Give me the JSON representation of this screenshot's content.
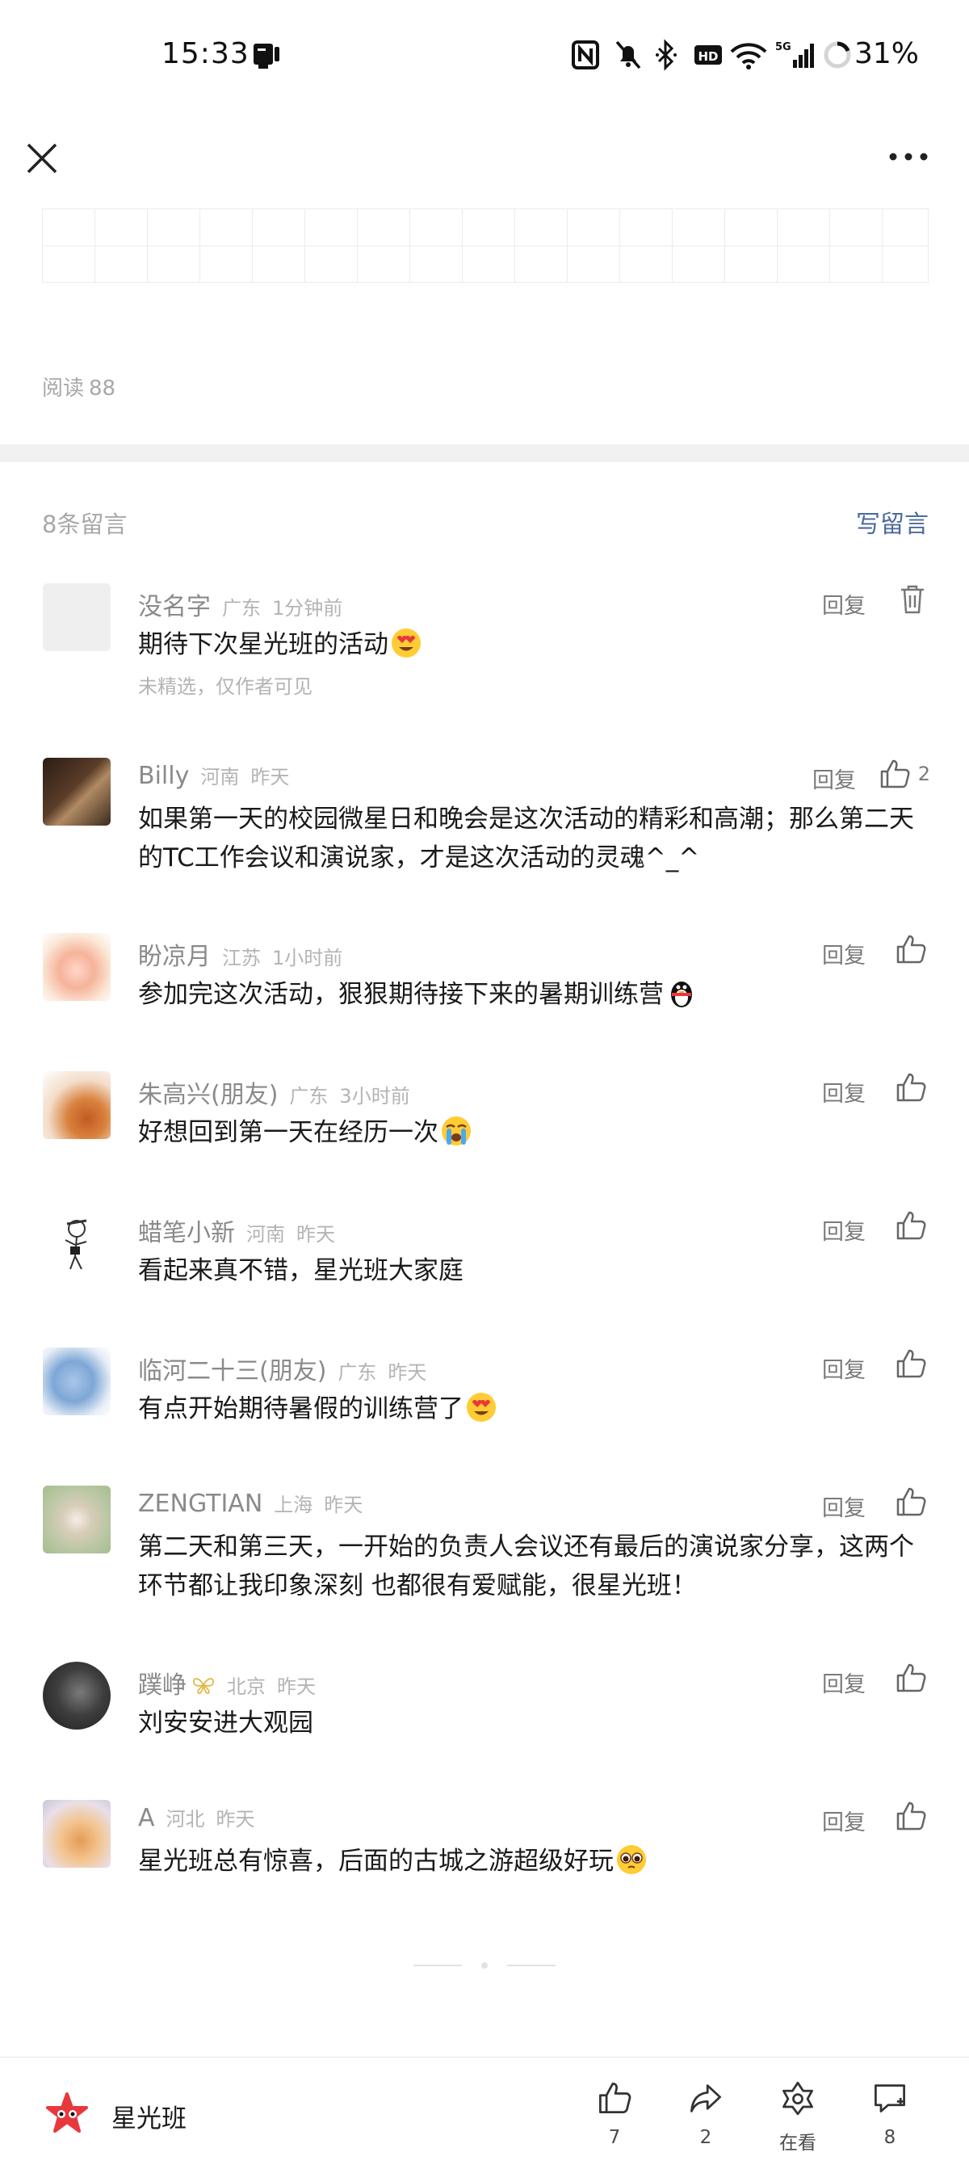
{
  "status_bar": {
    "time": "15:33",
    "battery": "31%",
    "icons": [
      "screen-record-icon",
      "nfc-icon",
      "mute-bell-icon",
      "bluetooth-icon",
      "hd-icon",
      "wifi-icon",
      "5g-signal-icon",
      "battery-ring-icon"
    ]
  },
  "nav": {
    "close_icon": "close-icon",
    "more_icon": "more-icon"
  },
  "article": {
    "read_label": "阅读",
    "read_count": "88"
  },
  "comments_section": {
    "count_label": "8条留言",
    "write_label": "写留言"
  },
  "comments": [
    {
      "name": "没名字",
      "location": "广东",
      "time": "1分钟前",
      "text": "期待下次星光班的活动",
      "emoji": "heart-eyes",
      "note": "未精选，仅作者可见",
      "reply": "回复",
      "action": "delete"
    },
    {
      "name": "Billy",
      "location": "河南",
      "time": "昨天",
      "text": "如果第一天的校园微星日和晚会是这次活动的精彩和高潮；那么第二天的TC工作会议和演说家，才是这次活动的灵魂^_^",
      "reply": "回复",
      "likes": "2"
    },
    {
      "name": "盼凉月",
      "location": "江苏",
      "time": "1小时前",
      "text": "参加完这次活动，狠狠期待接下来的暑期训练营",
      "emoji": "penguin",
      "reply": "回复"
    },
    {
      "name": "朱高兴(朋友)",
      "location": "广东",
      "time": "3小时前",
      "text": "好想回到第一天在经历一次",
      "emoji": "crying",
      "reply": "回复"
    },
    {
      "name": "蜡笔小新",
      "location": "河南",
      "time": "昨天",
      "text": "看起来真不错，星光班大家庭",
      "reply": "回复"
    },
    {
      "name": "临河二十三(朋友)",
      "location": "广东",
      "time": "昨天",
      "text": "有点开始期待暑假的训练营了",
      "emoji": "heart-eyes",
      "reply": "回复"
    },
    {
      "name": "ZENGTIAN",
      "location": "上海",
      "time": "昨天",
      "text": "第二天和第三天，一开始的负责人会议还有最后的演说家分享，这两个环节都让我印象深刻 也都很有爱赋能，很星光班！",
      "reply": "回复"
    },
    {
      "name": "蹼峥",
      "location": "北京",
      "time": "昨天",
      "text": "刘安安进大观园",
      "reply": "回复",
      "badge": "butterfly-icon"
    },
    {
      "name": "A",
      "location": "河北",
      "time": "昨天",
      "text": "星光班总有惊喜，后面的古城之游超级好玩",
      "emoji": "pleading",
      "reply": "回复"
    }
  ],
  "bottom_bar": {
    "account_name": "星光班",
    "like_count": "7",
    "share_count": "2",
    "wow_label": "在看",
    "comment_count": "8"
  },
  "colors": {
    "link": "#4c6b9e",
    "muted": "#a8a8a8",
    "accent_logo": "#e8383d"
  }
}
